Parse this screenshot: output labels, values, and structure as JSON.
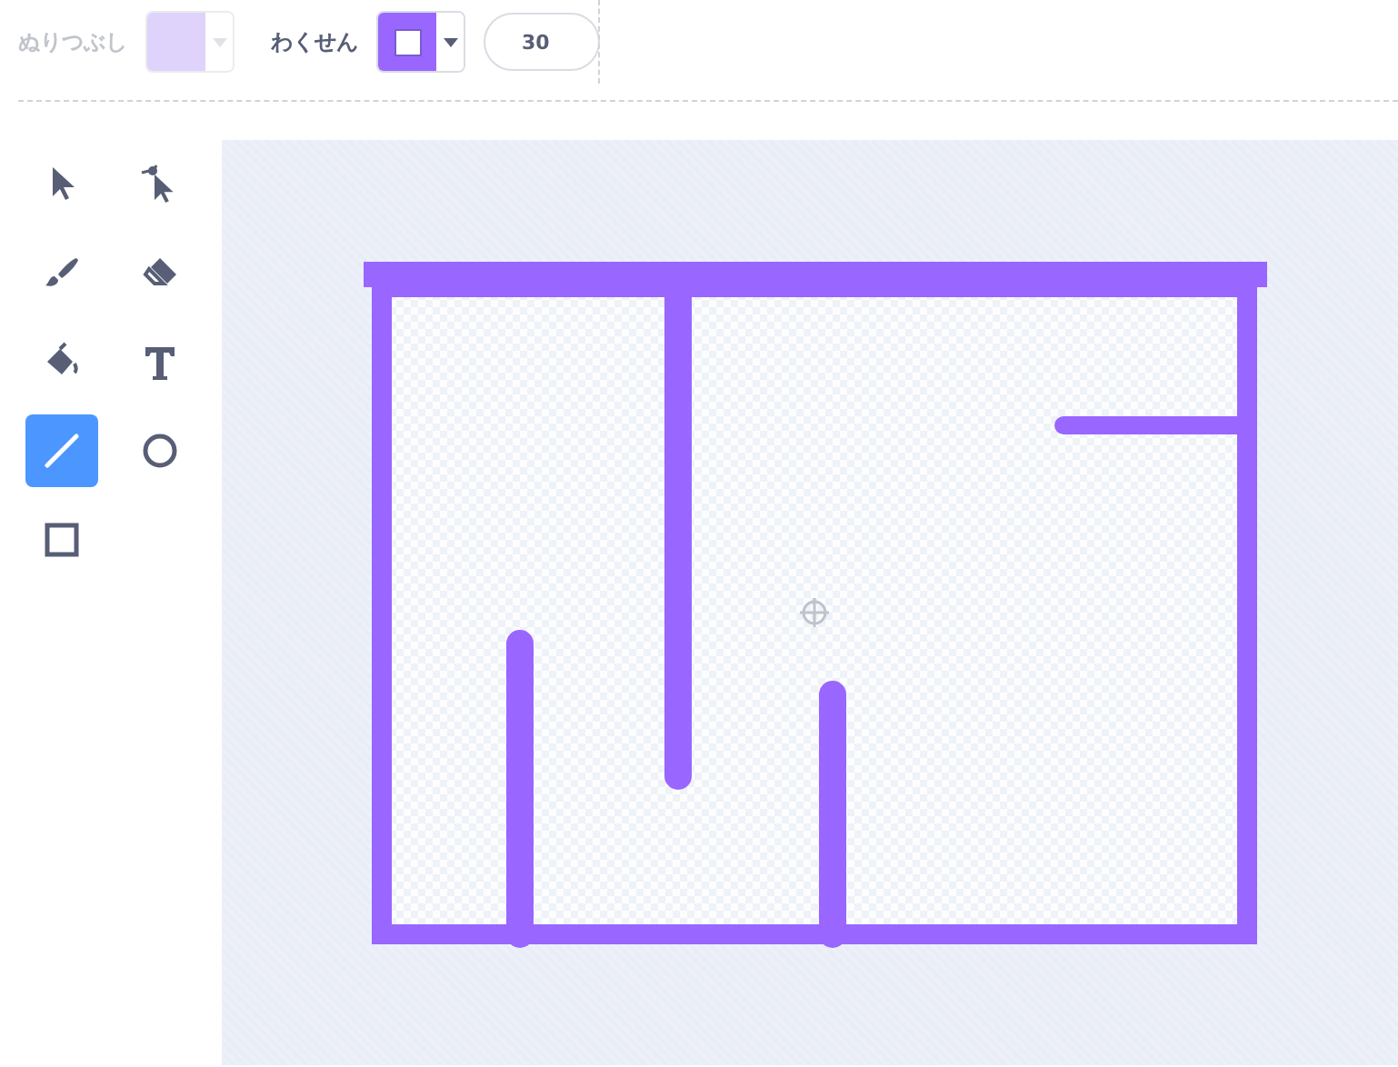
{
  "fill": {
    "label": "ぬりつぶし",
    "disabled": true
  },
  "stroke": {
    "label": "わくせん",
    "disabled": false
  },
  "stroke_width": {
    "value": "30"
  },
  "tools": [
    {
      "kind": "select",
      "selected": false
    },
    {
      "kind": "reshape",
      "selected": false
    },
    {
      "kind": "brush",
      "selected": false
    },
    {
      "kind": "eraser",
      "selected": false
    },
    {
      "kind": "fill",
      "selected": false
    },
    {
      "kind": "text",
      "selected": false
    },
    {
      "kind": "line",
      "selected": true
    },
    {
      "kind": "circle",
      "selected": false
    },
    {
      "kind": "rect",
      "selected": false
    }
  ]
}
